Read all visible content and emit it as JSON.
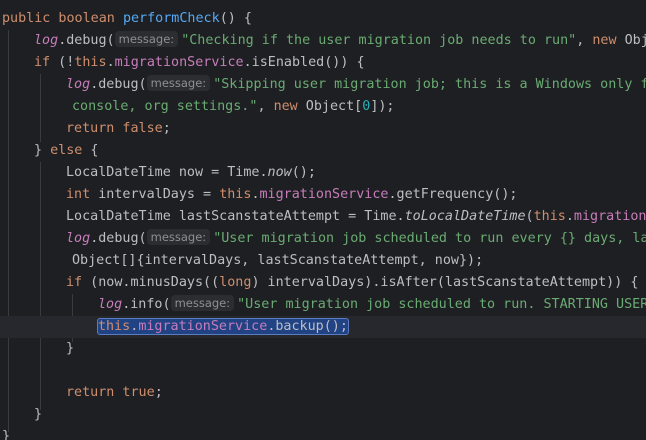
{
  "editor": {
    "language": "Java",
    "hint_label": "message:",
    "colors": {
      "background": "#1e1f22",
      "keyword": "#cf8e6d",
      "method": "#56a8f5",
      "field": "#c77dbb",
      "string": "#6aab73",
      "number": "#2aacb8",
      "selection": "#214283"
    },
    "code": {
      "l1_kw": "public boolean ",
      "l1_fn": "performCheck",
      "l1_rest": "() {",
      "l2_log": "log",
      "l2_call": ".debug(",
      "l2_str": "\"Checking if the user migration job needs to run\"",
      "l2_sep": ", ",
      "l2_kw": "new",
      "l2_rest": " Obje",
      "l3_kw": "if",
      "l3_a": " (!",
      "l3_this": "this",
      "l3_dot": ".",
      "l3_field": "migrationService",
      "l3_rest": ".isEnabled()) {",
      "l4_log": "log",
      "l4_call": ".debug(",
      "l4_str": "\"Skipping user migration job; this is a Windows only fe",
      "l5_str": "console, org settings.\"",
      "l5_sep": ", ",
      "l5_kw": "new",
      "l5_a": " Object[",
      "l5_num": "0",
      "l5_rest": "]);",
      "l6_kw": "return false",
      "l6_rest": ";",
      "l7_a": "} ",
      "l7_kw": "else",
      "l7_rest": " {",
      "l8_a": "LocalDateTime now = Time.",
      "l8_it": "now",
      "l8_rest": "();",
      "l9_kw": "int",
      "l9_a": " intervalDays = ",
      "l9_this": "this",
      "l9_dot": ".",
      "l9_field": "migrationService",
      "l9_rest": ".getFrequency();",
      "l10_a": "LocalDateTime lastScanstateAttempt = Time.",
      "l10_it": "toLocalDateTime",
      "l10_b": "(",
      "l10_this": "this",
      "l10_dot": ".",
      "l10_field": "migrationS",
      "l11_log": "log",
      "l11_call": ".debug(",
      "l11_str": "\"User migration job scheduled to run every {} days, las",
      "l12_a": "Object[]{intervalDays, lastScanstateAttempt, now});",
      "l13_kw": "if",
      "l13_a": " (now.minusDays((",
      "l13_kw2": "long",
      "l13_rest": ") intervalDays).isAfter(lastScanstateAttempt)) {",
      "l14_log": "log",
      "l14_call": ".info(",
      "l14_str": "\"User migration job scheduled to run. STARTING USERS",
      "l15_this": "this",
      "l15_dot": ".",
      "l15_field": "migrationService",
      "l15_rest": ".backup();",
      "l16": "}",
      "l18_kw": "return true",
      "l18_rest": ";",
      "l19": "}",
      "l20": "}"
    }
  }
}
